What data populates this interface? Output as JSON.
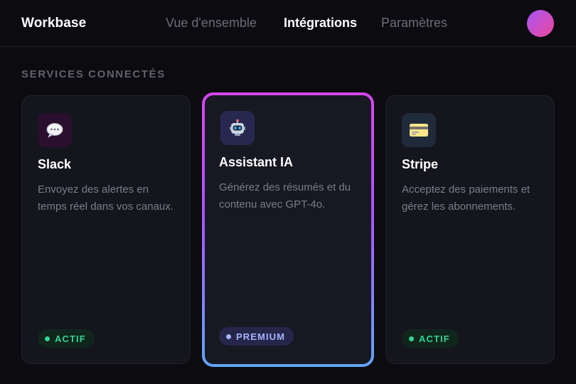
{
  "app": {
    "name": "Workbase"
  },
  "nav": {
    "items": [
      {
        "label": "Vue d'ensemble",
        "active": false
      },
      {
        "label": "Intégrations",
        "active": true
      },
      {
        "label": "Paramètres",
        "active": false
      }
    ]
  },
  "section": {
    "title": "SERVICES CONNECTÉS"
  },
  "cards": [
    {
      "icon": "speech-bubble-icon",
      "title": "Slack",
      "description": "Envoyez des alertes en temps réel dans vos canaux.",
      "badge": "ACTIF",
      "highlighted": false
    },
    {
      "icon": "robot-icon",
      "title": "Assistant IA",
      "description": "Générez des résumés et du contenu avec GPT-4o.",
      "badge": "PREMIUM",
      "highlighted": true
    },
    {
      "icon": "credit-card-icon",
      "title": "Stripe",
      "description": "Acceptez des paiements et gérez les abonnements.",
      "badge": "ACTIF",
      "highlighted": false
    }
  ],
  "colors": {
    "background": "#0b0b10",
    "card": "#15151d",
    "accent_gradient_start": "#d946ef",
    "accent_gradient_end": "#60a5fa",
    "active_badge": "#34d399",
    "premium_badge": "#a5b4fc"
  }
}
